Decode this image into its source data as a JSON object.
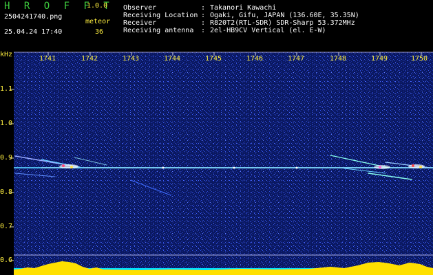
{
  "app": {
    "name": "H R O F F T",
    "version": "1.0.0"
  },
  "file": {
    "name": "2504241740.png",
    "datetime": "25.04.24 17:40"
  },
  "meteor": {
    "label": "meteor",
    "count": "36"
  },
  "info": [
    {
      "key": "Observer",
      "sep": ":",
      "value": "Takanori Kawachi"
    },
    {
      "key": "Receiving Location",
      "sep": ":",
      "value": "Ogaki, Gifu, JAPAN (136.60E, 35.35N)"
    },
    {
      "key": "Receiver",
      "sep": ":",
      "value": "R820T2(RTL-SDR) SDR-Sharp 53.372MHz"
    },
    {
      "key": "Receiving antenna",
      "sep": ":",
      "value": "2el-HB9CV Vertical (el. E-W)"
    }
  ],
  "axis": {
    "y_unit": "kHz",
    "y_ticks": [
      "1.1",
      "1.0",
      "0.9",
      "0.8",
      "0.7",
      "0.6"
    ],
    "x_ticks": [
      "1741",
      "1742",
      "1743",
      "1744",
      "1745",
      "1746",
      "1747",
      "1748",
      "1749",
      "1750"
    ]
  },
  "colors": {
    "background": "#000000",
    "spectrum": "#0a1860",
    "label": "#ffef3f",
    "logo": "#3fcf3f"
  }
}
